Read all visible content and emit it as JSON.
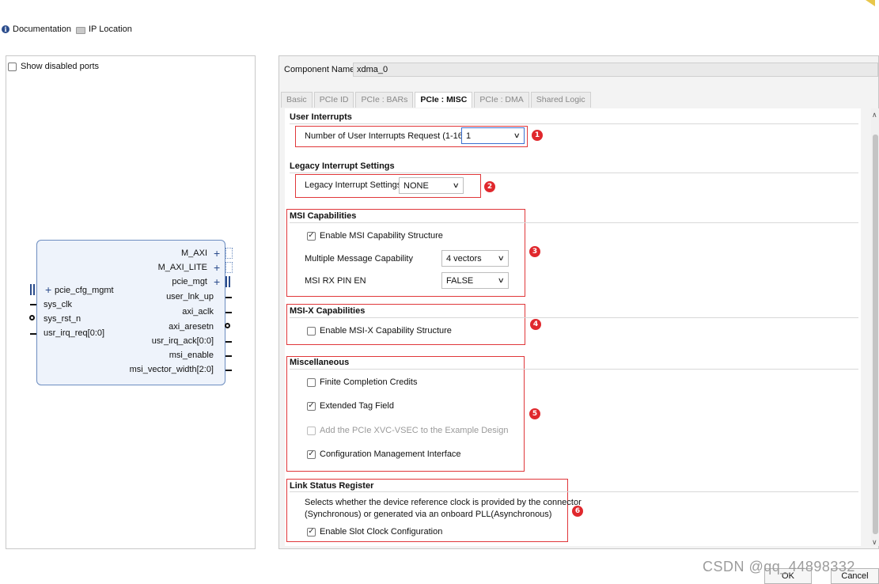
{
  "toolbar": {
    "documentation": "Documentation",
    "ip_location": "IP Location"
  },
  "left": {
    "show_disabled_ports": "Show disabled ports",
    "block": {
      "right_pins": [
        "M_AXI",
        "M_AXI_LITE",
        "pcie_mgt",
        "user_lnk_up",
        "axi_aclk",
        "axi_aresetn",
        "usr_irq_ack[0:0]",
        "msi_enable",
        "msi_vector_width[2:0]"
      ],
      "left_pins": [
        "pcie_cfg_mgmt",
        "sys_clk",
        "sys_rst_n",
        "usr_irq_req[0:0]"
      ]
    }
  },
  "component": {
    "label": "Component Name",
    "value": "xdma_0"
  },
  "tabs": [
    "Basic",
    "PCIe ID",
    "PCIe : BARs",
    "PCIe : MISC",
    "PCIe : DMA",
    "Shared Logic"
  ],
  "sections": {
    "user_interrupts": {
      "title": "User Interrupts",
      "label": "Number of User Interrupts Request (1-16)",
      "value": "1"
    },
    "legacy": {
      "title": "Legacy Interrupt Settings",
      "label": "Legacy Interrupt Settings",
      "value": "NONE"
    },
    "msi": {
      "title": "MSI Capabilities",
      "enable_label": "Enable MSI Capability Structure",
      "multi_label": "Multiple Message Capability",
      "multi_value": "4 vectors",
      "rx_label": "MSI RX PIN EN",
      "rx_value": "FALSE"
    },
    "msix": {
      "title": "MSI-X Capabilities",
      "enable_label": "Enable MSI-X Capability Structure"
    },
    "misc": {
      "title": "Miscellaneous",
      "finite": "Finite Completion Credits",
      "extended": "Extended Tag Field",
      "xvc": "Add the PCIe XVC-VSEC to the Example Design",
      "cfg_mgmt": "Configuration Management Interface"
    },
    "link": {
      "title": "Link Status Register",
      "desc1": "Selects whether the device reference clock is provided by the connector",
      "desc2": "(Synchronous) or generated via an onboard PLL(Asynchronous)",
      "enable_label": "Enable Slot Clock Configuration"
    }
  },
  "badges": [
    "1",
    "2",
    "3",
    "4",
    "5",
    "6"
  ],
  "buttons": {
    "ok": "OK",
    "cancel": "Cancel"
  },
  "watermark": "CSDN @qq_44898332",
  "colors": {
    "annotation_red": "#e0373a",
    "block_border": "#6d8dc0",
    "block_fill": "#eef3fb"
  }
}
